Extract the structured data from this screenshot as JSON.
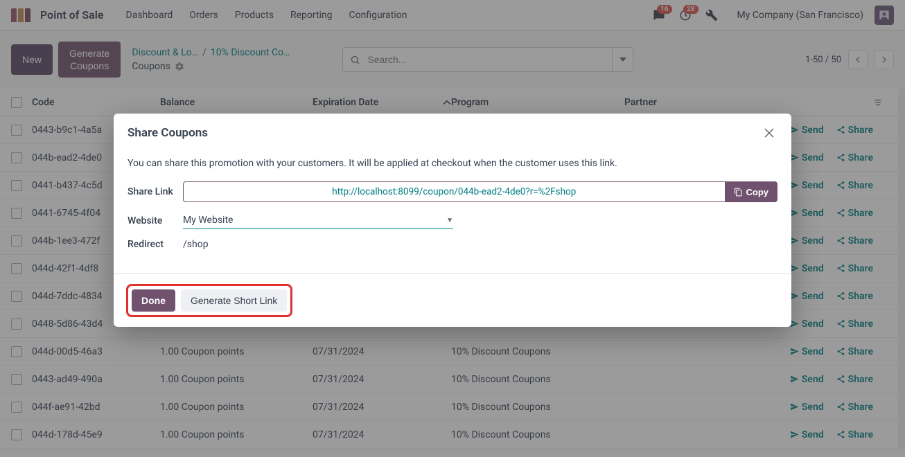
{
  "nav": {
    "app_name": "Point of Sale",
    "links": [
      "Dashboard",
      "Orders",
      "Products",
      "Reporting",
      "Configuration"
    ],
    "msg_count": "16",
    "activity_count": "28",
    "company": "My Company (San Francisco)"
  },
  "toolbar": {
    "new_label": "New",
    "generate_label": "Generate\nCoupons",
    "crumb1": "Discount & Lo…",
    "crumb2": "10% Discount Co…",
    "crumb3": "Coupons",
    "search_placeholder": "Search...",
    "pager": "1-50 / 50"
  },
  "table": {
    "headers": {
      "code": "Code",
      "balance": "Balance",
      "exp": "Expiration Date",
      "program": "Program",
      "partner": "Partner"
    },
    "send_label": "Send",
    "share_label": "Share",
    "rows": [
      {
        "code": "0443-b9c1-4a5a",
        "balance": "",
        "exp": "",
        "program": "",
        "partner": ""
      },
      {
        "code": "044b-ead2-4de0",
        "balance": "",
        "exp": "",
        "program": "",
        "partner": ""
      },
      {
        "code": "0441-b437-4c5d",
        "balance": "",
        "exp": "",
        "program": "",
        "partner": ""
      },
      {
        "code": "0441-6745-4f04",
        "balance": "",
        "exp": "",
        "program": "",
        "partner": ""
      },
      {
        "code": "044b-1ee3-472f",
        "balance": "",
        "exp": "",
        "program": "",
        "partner": ""
      },
      {
        "code": "044d-42f1-4df8",
        "balance": "",
        "exp": "",
        "program": "",
        "partner": ""
      },
      {
        "code": "044d-7ddc-4834",
        "balance": "",
        "exp": "",
        "program": "",
        "partner": ""
      },
      {
        "code": "0448-5d86-43d4",
        "balance": "",
        "exp": "",
        "program": "",
        "partner": ""
      },
      {
        "code": "044d-00d5-46a3",
        "balance": "1.00 Coupon points",
        "exp": "07/31/2024",
        "program": "10% Discount Coupons",
        "partner": ""
      },
      {
        "code": "0443-ad49-490a",
        "balance": "1.00 Coupon points",
        "exp": "07/31/2024",
        "program": "10% Discount Coupons",
        "partner": ""
      },
      {
        "code": "044f-ae91-42bd",
        "balance": "1.00 Coupon points",
        "exp": "07/31/2024",
        "program": "10% Discount Coupons",
        "partner": ""
      },
      {
        "code": "044d-178d-45e9",
        "balance": "1.00 Coupon points",
        "exp": "07/31/2024",
        "program": "10% Discount Coupons",
        "partner": ""
      }
    ]
  },
  "modal": {
    "title": "Share Coupons",
    "desc": "You can share this promotion with your customers. It will be applied at checkout when the customer uses this link.",
    "share_label": "Share Link",
    "share_url": "http://localhost:8099/coupon/044b-ead2-4de0?r=%2Fshop",
    "copy_label": "Copy",
    "website_label": "Website",
    "website_value": "My Website",
    "redirect_label": "Redirect",
    "redirect_value": "/shop",
    "done_label": "Done",
    "short_label": "Generate Short Link"
  }
}
